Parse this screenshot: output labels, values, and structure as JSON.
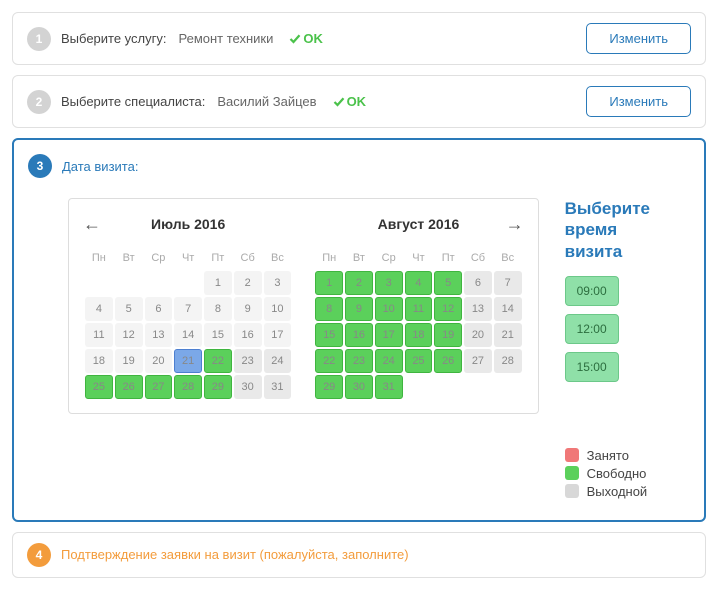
{
  "steps": {
    "s1": {
      "num": "1",
      "label": "Выберите услугу:",
      "value": "Ремонт техники",
      "ok": "OK",
      "change": "Изменить"
    },
    "s2": {
      "num": "2",
      "label": "Выберите специалиста:",
      "value": "Василий Зайцев",
      "ok": "OK",
      "change": "Изменить"
    },
    "s3": {
      "num": "3",
      "label": "Дата визита:"
    },
    "s4": {
      "num": "4",
      "label": "Подтверждение заявки на визит (пожалуйста, заполните)"
    }
  },
  "dow": [
    "Пн",
    "Вт",
    "Ср",
    "Чт",
    "Пт",
    "Сб",
    "Вс"
  ],
  "months": {
    "m1": {
      "title": "Июль 2016",
      "weeks": [
        [
          null,
          null,
          null,
          null,
          {
            "n": 1,
            "s": "past"
          },
          {
            "n": 2,
            "s": "past"
          },
          {
            "n": 3,
            "s": "past"
          }
        ],
        [
          {
            "n": 4,
            "s": "past"
          },
          {
            "n": 5,
            "s": "past"
          },
          {
            "n": 6,
            "s": "past"
          },
          {
            "n": 7,
            "s": "past"
          },
          {
            "n": 8,
            "s": "past"
          },
          {
            "n": 9,
            "s": "past"
          },
          {
            "n": 10,
            "s": "past"
          }
        ],
        [
          {
            "n": 11,
            "s": "past"
          },
          {
            "n": 12,
            "s": "past"
          },
          {
            "n": 13,
            "s": "past"
          },
          {
            "n": 14,
            "s": "past"
          },
          {
            "n": 15,
            "s": "past"
          },
          {
            "n": 16,
            "s": "past"
          },
          {
            "n": 17,
            "s": "past"
          }
        ],
        [
          {
            "n": 18,
            "s": "past"
          },
          {
            "n": 19,
            "s": "past"
          },
          {
            "n": 20,
            "s": "past"
          },
          {
            "n": 21,
            "s": "sel"
          },
          {
            "n": 22,
            "s": "free"
          },
          {
            "n": 23,
            "s": "off"
          },
          {
            "n": 24,
            "s": "off"
          }
        ],
        [
          {
            "n": 25,
            "s": "free"
          },
          {
            "n": 26,
            "s": "free"
          },
          {
            "n": 27,
            "s": "free"
          },
          {
            "n": 28,
            "s": "free"
          },
          {
            "n": 29,
            "s": "free"
          },
          {
            "n": 30,
            "s": "off"
          },
          {
            "n": 31,
            "s": "off"
          }
        ]
      ]
    },
    "m2": {
      "title": "Август 2016",
      "weeks": [
        [
          {
            "n": 1,
            "s": "free"
          },
          {
            "n": 2,
            "s": "free"
          },
          {
            "n": 3,
            "s": "free"
          },
          {
            "n": 4,
            "s": "free"
          },
          {
            "n": 5,
            "s": "free"
          },
          {
            "n": 6,
            "s": "off"
          },
          {
            "n": 7,
            "s": "off"
          }
        ],
        [
          {
            "n": 8,
            "s": "free"
          },
          {
            "n": 9,
            "s": "free"
          },
          {
            "n": 10,
            "s": "free"
          },
          {
            "n": 11,
            "s": "free"
          },
          {
            "n": 12,
            "s": "free"
          },
          {
            "n": 13,
            "s": "off"
          },
          {
            "n": 14,
            "s": "off"
          }
        ],
        [
          {
            "n": 15,
            "s": "free"
          },
          {
            "n": 16,
            "s": "free"
          },
          {
            "n": 17,
            "s": "free"
          },
          {
            "n": 18,
            "s": "free"
          },
          {
            "n": 19,
            "s": "free"
          },
          {
            "n": 20,
            "s": "off"
          },
          {
            "n": 21,
            "s": "off"
          }
        ],
        [
          {
            "n": 22,
            "s": "free"
          },
          {
            "n": 23,
            "s": "free"
          },
          {
            "n": 24,
            "s": "free"
          },
          {
            "n": 25,
            "s": "free"
          },
          {
            "n": 26,
            "s": "free"
          },
          {
            "n": 27,
            "s": "off"
          },
          {
            "n": 28,
            "s": "off"
          }
        ],
        [
          {
            "n": 29,
            "s": "free"
          },
          {
            "n": 30,
            "s": "free"
          },
          {
            "n": 31,
            "s": "free"
          },
          null,
          null,
          null,
          null
        ]
      ]
    }
  },
  "time": {
    "title": "Выберите время визита",
    "slots": [
      "09:00",
      "12:00",
      "15:00"
    ]
  },
  "legend": {
    "busy": "Занято",
    "free": "Свободно",
    "off": "Выходной"
  }
}
